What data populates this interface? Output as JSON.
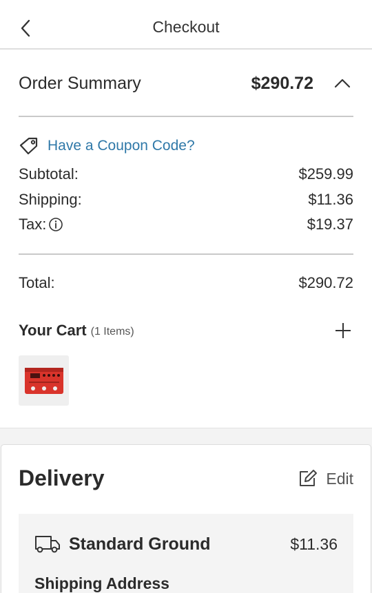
{
  "header": {
    "title": "Checkout",
    "back_icon": "chevron-left-icon"
  },
  "order_summary": {
    "label": "Order Summary",
    "total": "$290.72",
    "toggle_icon": "chevron-up-icon"
  },
  "coupon": {
    "icon": "tag-icon",
    "label": "Have a Coupon Code?"
  },
  "costs": {
    "subtotal_label": "Subtotal:",
    "subtotal_value": "$259.99",
    "shipping_label": "Shipping:",
    "shipping_value": "$11.36",
    "tax_label": "Tax:",
    "tax_info_icon": "info-icon",
    "tax_value": "$19.37",
    "total_label": "Total:",
    "total_value": "$290.72"
  },
  "cart": {
    "title": "Your Cart",
    "count": "(1 Items)",
    "add_icon": "plus-icon",
    "item_image": "red-effects-pedal-thumbnail"
  },
  "delivery": {
    "title": "Delivery",
    "edit_label": "Edit",
    "edit_icon": "pencil-icon",
    "method_icon": "truck-icon",
    "method_name": "Standard Ground",
    "method_price": "$11.36",
    "shipping_address_label": "Shipping Address"
  },
  "colors": {
    "link": "#2f78a8",
    "text": "#2b2b2b",
    "divider": "#c9c9c9",
    "panel": "#f4f4f4"
  }
}
